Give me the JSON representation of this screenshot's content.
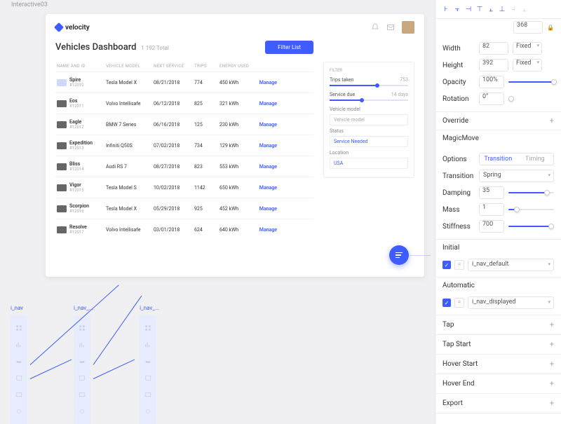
{
  "canvas": {
    "artboardLabel": "Interactive03"
  },
  "artboard": {
    "logo": "velocity",
    "title": "Vehicles Dashboard",
    "subtitle": "1 192 Total",
    "filterButton": "Filter List",
    "columns": {
      "name": "NAME AND ID",
      "model": "VEHICLE MODEL",
      "next": "NEXT SERVICE",
      "trips": "TRIPS",
      "energy": "ENERGY USED"
    },
    "manageLabel": "Manage",
    "rows": [
      {
        "name": "Spire",
        "id": "#12010",
        "model": "Tesla Model X",
        "next": "08/21/2018",
        "trips": "774",
        "energy": "450 kWh",
        "thumbClass": "sm"
      },
      {
        "name": "Eos",
        "id": "#12011",
        "model": "Volvo Intellisafe",
        "next": "06/12/2018",
        "trips": "825",
        "energy": "321 kWh"
      },
      {
        "name": "Eagle",
        "id": "#12012",
        "model": "BMW 7 Series",
        "next": "06/16/2018",
        "trips": "125",
        "energy": "230 kWh"
      },
      {
        "name": "Expedition",
        "id": "#12013",
        "model": "Infiniti Q50S",
        "next": "07/02/2018",
        "trips": "734",
        "energy": "129 kWh"
      },
      {
        "name": "Bliss",
        "id": "#12014",
        "model": "Audi RS 7",
        "next": "08/27/2018",
        "trips": "823",
        "energy": "553 kWh"
      },
      {
        "name": "Vigor",
        "id": "#12015",
        "model": "Tesla Model S",
        "next": "10/02/2018",
        "trips": "1142",
        "energy": "650 kWh"
      },
      {
        "name": "Scorpion",
        "id": "#12016",
        "model": "Tesla Model X",
        "next": "05/29/2018",
        "trips": "925",
        "energy": "452 kWh"
      },
      {
        "name": "Resolve",
        "id": "#12017",
        "model": "Volvo Intellisafe",
        "next": "03/01/2018",
        "trips": "624",
        "energy": "640 kWh"
      }
    ],
    "filter": {
      "heading": "FILTER",
      "tripsLabel": "Trips taken",
      "tripsValue": "753",
      "serviceLabel": "Service due",
      "serviceValue": "14 days",
      "vehicleModelLabel": "Vehicle model",
      "vehicleModelPh": "Vehicle model",
      "statusLabel": "Status",
      "statusValue": "Service Needed",
      "locationLabel": "Location",
      "locationValue": "USA"
    }
  },
  "miniNavLabels": [
    "i_nav",
    "i_nav_...",
    "i_nav_..."
  ],
  "inspector": {
    "y": "368",
    "width": {
      "label": "Width",
      "value": "82",
      "mode": "Fixed"
    },
    "height": {
      "label": "Height",
      "value": "392",
      "mode": "Fixed"
    },
    "opacity": {
      "label": "Opacity",
      "value": "100%"
    },
    "rotation": {
      "label": "Rotation",
      "value": "0°"
    },
    "override": "Override",
    "magicMove": "MagicMove",
    "options": {
      "label": "Options",
      "a": "Transition",
      "b": "Timing"
    },
    "transition": {
      "label": "Transition",
      "value": "Spring"
    },
    "damping": {
      "label": "Damping",
      "value": "35"
    },
    "mass": {
      "label": "Mass",
      "value": "1"
    },
    "stiffness": {
      "label": "Stiffness",
      "value": "700"
    },
    "initial": {
      "label": "Initial",
      "value": "i_nav_default"
    },
    "automatic": {
      "label": "Automatic",
      "value": "i_nav_displayed"
    },
    "events": [
      "Tap",
      "Tap Start",
      "Hover Start",
      "Hover End",
      "Export"
    ]
  }
}
